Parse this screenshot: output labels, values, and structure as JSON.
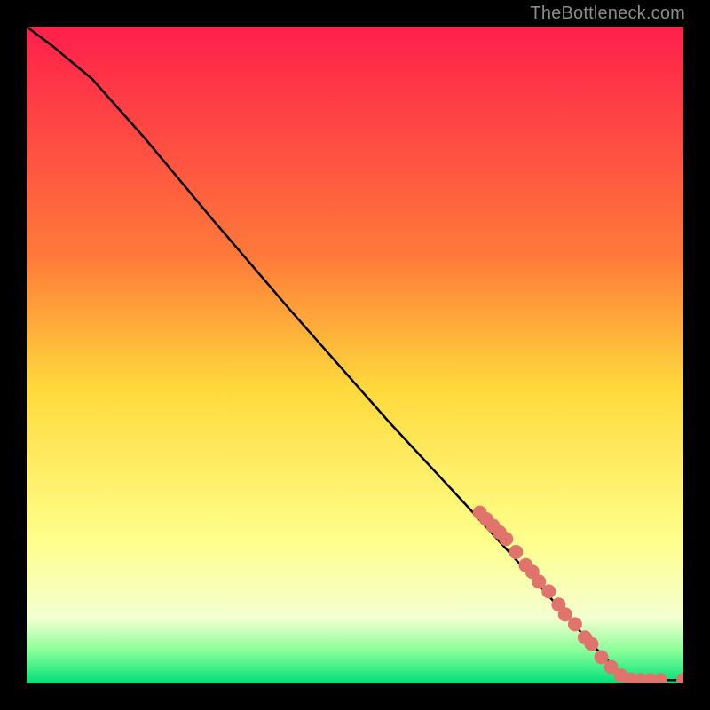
{
  "attribution": "TheBottleneck.com",
  "chart_data": {
    "type": "line",
    "title": "",
    "xlabel": "",
    "ylabel": "",
    "xlim": [
      0,
      100
    ],
    "ylim": [
      0,
      100
    ],
    "background_gradient": {
      "stops": [
        {
          "offset": 0,
          "color": "#ff1f4b"
        },
        {
          "offset": 35,
          "color": "#ff7a3a"
        },
        {
          "offset": 55,
          "color": "#ffd93b"
        },
        {
          "offset": 78,
          "color": "#ffff8a"
        },
        {
          "offset": 90,
          "color": "#f4ffd1"
        },
        {
          "offset": 95,
          "color": "#8aff9a"
        },
        {
          "offset": 100,
          "color": "#00e07a"
        }
      ]
    },
    "curve": [
      {
        "x": 0,
        "y": 100
      },
      {
        "x": 4,
        "y": 97
      },
      {
        "x": 10,
        "y": 92
      },
      {
        "x": 18,
        "y": 83
      },
      {
        "x": 28,
        "y": 71
      },
      {
        "x": 40,
        "y": 57
      },
      {
        "x": 55,
        "y": 40
      },
      {
        "x": 68,
        "y": 26
      },
      {
        "x": 78,
        "y": 15
      },
      {
        "x": 86,
        "y": 6
      },
      {
        "x": 90,
        "y": 2
      },
      {
        "x": 92,
        "y": 0.5
      },
      {
        "x": 100,
        "y": 0.5
      }
    ],
    "series": [
      {
        "name": "markers",
        "color": "#e0746d",
        "points": [
          {
            "x": 69,
            "y": 26
          },
          {
            "x": 70,
            "y": 25
          },
          {
            "x": 71,
            "y": 24
          },
          {
            "x": 72,
            "y": 23
          },
          {
            "x": 73,
            "y": 22
          },
          {
            "x": 74.5,
            "y": 20
          },
          {
            "x": 76,
            "y": 18
          },
          {
            "x": 77,
            "y": 17
          },
          {
            "x": 78,
            "y": 15.5
          },
          {
            "x": 79.5,
            "y": 14
          },
          {
            "x": 81,
            "y": 12
          },
          {
            "x": 82,
            "y": 10.5
          },
          {
            "x": 83.5,
            "y": 9
          },
          {
            "x": 85,
            "y": 7
          },
          {
            "x": 86,
            "y": 6
          },
          {
            "x": 87.5,
            "y": 4
          },
          {
            "x": 89,
            "y": 2.5
          },
          {
            "x": 90.5,
            "y": 1.2
          },
          {
            "x": 92,
            "y": 0.6
          },
          {
            "x": 93.5,
            "y": 0.5
          },
          {
            "x": 95,
            "y": 0.5
          },
          {
            "x": 96.5,
            "y": 0.5
          },
          {
            "x": 100,
            "y": 0.5
          }
        ]
      }
    ]
  }
}
